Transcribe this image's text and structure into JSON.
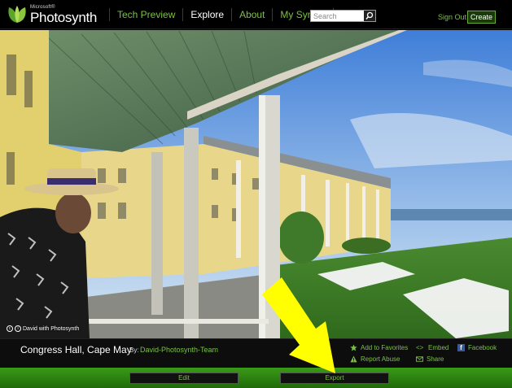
{
  "header": {
    "logo_small": "Microsoft®",
    "logo_name": "Photosynth",
    "nav": [
      {
        "label": "Tech Preview",
        "active": false
      },
      {
        "label": "Explore",
        "active": true
      },
      {
        "label": "About",
        "active": false
      },
      {
        "label": "My Synths",
        "active": false
      }
    ],
    "search_placeholder": "Search",
    "sign_out": "Sign Out",
    "create": "Create"
  },
  "viewer": {
    "credit": "David with Photosynth"
  },
  "info": {
    "title": "Congress Hall, Cape May",
    "by_label": "By:",
    "author": "David-Photosynth-Team",
    "actions": {
      "favorites": "Add to Favorites",
      "embed": "Embed",
      "facebook": "Facebook",
      "report": "Report Abuse",
      "share": "Share"
    }
  },
  "bottom": {
    "edit": "Edit",
    "export": "Export"
  },
  "colors": {
    "accent_green": "#7ac142",
    "bar_green": "#2a7a10",
    "annotation_arrow": "#ffff00"
  }
}
